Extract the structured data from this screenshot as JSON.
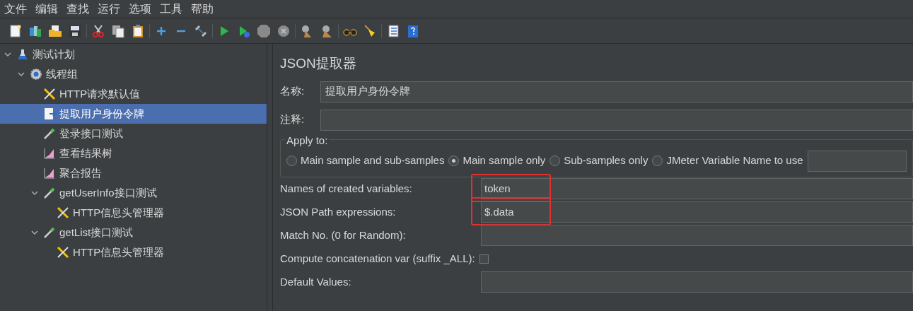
{
  "menu": [
    "文件",
    "编辑",
    "查找",
    "运行",
    "选项",
    "工具",
    "帮助"
  ],
  "toolbar": [
    [
      {
        "kind": "new"
      },
      {
        "kind": "templates"
      },
      {
        "kind": "open"
      },
      {
        "kind": "save"
      }
    ],
    [
      {
        "kind": "cut"
      },
      {
        "kind": "copy"
      },
      {
        "kind": "paste"
      }
    ],
    [
      {
        "kind": "add"
      },
      {
        "kind": "remove"
      },
      {
        "kind": "toggle"
      }
    ],
    [
      {
        "kind": "start"
      },
      {
        "kind": "start-no-pause"
      },
      {
        "kind": "stop"
      },
      {
        "kind": "shutdown"
      }
    ],
    [
      {
        "kind": "clear"
      },
      {
        "kind": "clear-all"
      }
    ],
    [
      {
        "kind": "search"
      },
      {
        "kind": "reset"
      }
    ],
    [
      {
        "kind": "functions"
      },
      {
        "kind": "help"
      }
    ]
  ],
  "tree": [
    {
      "label": "测试计划",
      "kind": "plan",
      "expanded": true,
      "selected": false,
      "children": [
        {
          "label": "线程组",
          "kind": "threads",
          "expanded": true,
          "selected": false,
          "children": [
            {
              "label": "HTTP请求默认值",
              "kind": "config",
              "selected": false
            },
            {
              "label": "提取用户身份令牌",
              "kind": "extractor",
              "selected": true
            },
            {
              "label": "登录接口测试",
              "kind": "sampler",
              "selected": false
            },
            {
              "label": "查看结果树",
              "kind": "listener",
              "selected": false
            },
            {
              "label": "聚合报告",
              "kind": "listener",
              "selected": false
            },
            {
              "label": "getUserInfo接口测试",
              "kind": "sampler",
              "expanded": true,
              "selected": false,
              "children": [
                {
                  "label": "HTTP信息头管理器",
                  "kind": "config",
                  "selected": false
                }
              ]
            },
            {
              "label": "getList接口测试",
              "kind": "sampler",
              "expanded": true,
              "selected": false,
              "children": [
                {
                  "label": "HTTP信息头管理器",
                  "kind": "config",
                  "selected": false
                }
              ]
            }
          ]
        }
      ]
    }
  ],
  "panel": {
    "title": "JSON提取器",
    "name": {
      "label": "名称:",
      "value": "提取用户身份令牌"
    },
    "comment": {
      "label": "注释:"
    },
    "apply_to": {
      "legend": "Apply to:",
      "options": [
        {
          "label": "Main sample and sub-samples",
          "selected": false
        },
        {
          "label": "Main sample only",
          "selected": true
        },
        {
          "label": "Sub-samples only",
          "selected": false
        },
        {
          "label": "JMeter Variable Name to use",
          "selected": false
        }
      ]
    },
    "fields": [
      {
        "label": "Names of created variables:",
        "kind": "text",
        "value": "token",
        "highlighted": true
      },
      {
        "label": "JSON Path expressions:",
        "kind": "text",
        "value": "$.data",
        "highlighted": true
      },
      {
        "label": "Match No. (0 for Random):",
        "kind": "text",
        "highlighted": false
      },
      {
        "label": "Compute concatenation var (suffix _ALL):",
        "kind": "checkbox",
        "checked": false
      },
      {
        "label": "Default Values:",
        "kind": "text",
        "highlighted": false
      }
    ]
  }
}
